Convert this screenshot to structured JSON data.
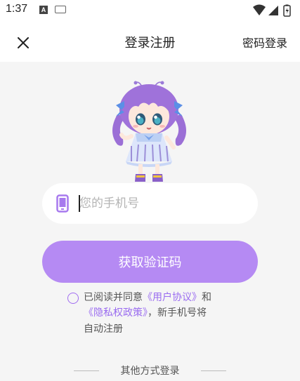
{
  "status_bar": {
    "time": "1:37",
    "a_badge": "A",
    "icons": [
      "wifi-icon",
      "signal-icon",
      "battery-icon"
    ]
  },
  "nav": {
    "title": "登录注册",
    "right_link": "密码登录",
    "close_icon": "close-icon"
  },
  "phone_field": {
    "placeholder": "您的手机号",
    "value": "",
    "icon": "phone-icon"
  },
  "submit_button": {
    "label": "获取验证码"
  },
  "agreement": {
    "prefix": "已阅读并同意",
    "user_agreement": "《用户协议》",
    "and": "和",
    "privacy_policy": "《隐私权政策》",
    "suffix_line2": "，新手机号将",
    "line3": "自动注册",
    "checked": false
  },
  "other_login": {
    "label": "其他方式登录"
  },
  "colors": {
    "accent": "#b58af3",
    "link": "#9a6cf0",
    "background": "#f5f5f5"
  }
}
